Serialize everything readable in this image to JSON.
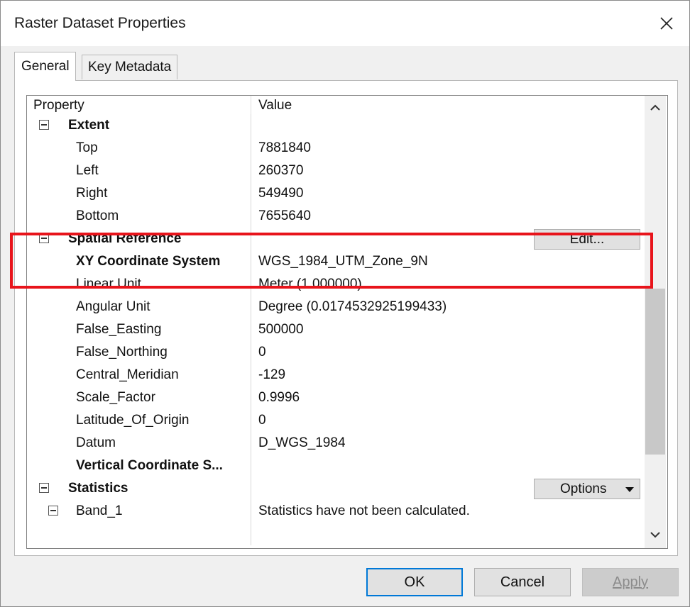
{
  "window": {
    "title": "Raster Dataset Properties"
  },
  "tabs": [
    {
      "label": "General",
      "active": true
    },
    {
      "label": "Key Metadata",
      "active": false
    }
  ],
  "grid": {
    "header": {
      "property": "Property",
      "value": "Value"
    },
    "rows": [
      {
        "label": "Extent",
        "value": "",
        "bold": true,
        "level": 0,
        "expander": true
      },
      {
        "label": "Top",
        "value": "7881840",
        "level": 1
      },
      {
        "label": "Left",
        "value": "260370",
        "level": 1
      },
      {
        "label": "Right",
        "value": "549490",
        "level": 1
      },
      {
        "label": "Bottom",
        "value": "7655640",
        "level": 1
      },
      {
        "label": "Spatial Reference",
        "value": "",
        "bold": true,
        "level": 0,
        "expander": true,
        "button": "Edit..."
      },
      {
        "label": "XY Coordinate System",
        "value": "WGS_1984_UTM_Zone_9N",
        "bold": true,
        "level": 1
      },
      {
        "label": "Linear Unit",
        "value": "Meter (1.000000)",
        "level": 1
      },
      {
        "label": "Angular Unit",
        "value": "Degree (0.0174532925199433)",
        "level": 1
      },
      {
        "label": "False_Easting",
        "value": "500000",
        "level": 1
      },
      {
        "label": "False_Northing",
        "value": "0",
        "level": 1
      },
      {
        "label": "Central_Meridian",
        "value": "-129",
        "level": 1
      },
      {
        "label": "Scale_Factor",
        "value": "0.9996",
        "level": 1
      },
      {
        "label": "Latitude_Of_Origin",
        "value": "0",
        "level": 1
      },
      {
        "label": "Datum",
        "value": "D_WGS_1984",
        "level": 1
      },
      {
        "label": "Vertical Coordinate S...",
        "value": "",
        "bold": true,
        "level": 1
      },
      {
        "label": "Statistics",
        "value": "",
        "bold": true,
        "level": 0,
        "expander": true,
        "button": "Options"
      },
      {
        "label": "Band_1",
        "value": "Statistics have not been calculated.",
        "level": 1,
        "expander": true
      }
    ]
  },
  "buttons": {
    "ok": "OK",
    "cancel": "Cancel",
    "apply": "Apply"
  },
  "icons": {
    "close": "close-icon",
    "scroll_up": "chevron-up-icon",
    "scroll_down": "chevron-down-icon",
    "dropdown": "caret-down-icon"
  },
  "colors": {
    "highlight": "#e8141b",
    "default_button_border": "#0078d7"
  }
}
